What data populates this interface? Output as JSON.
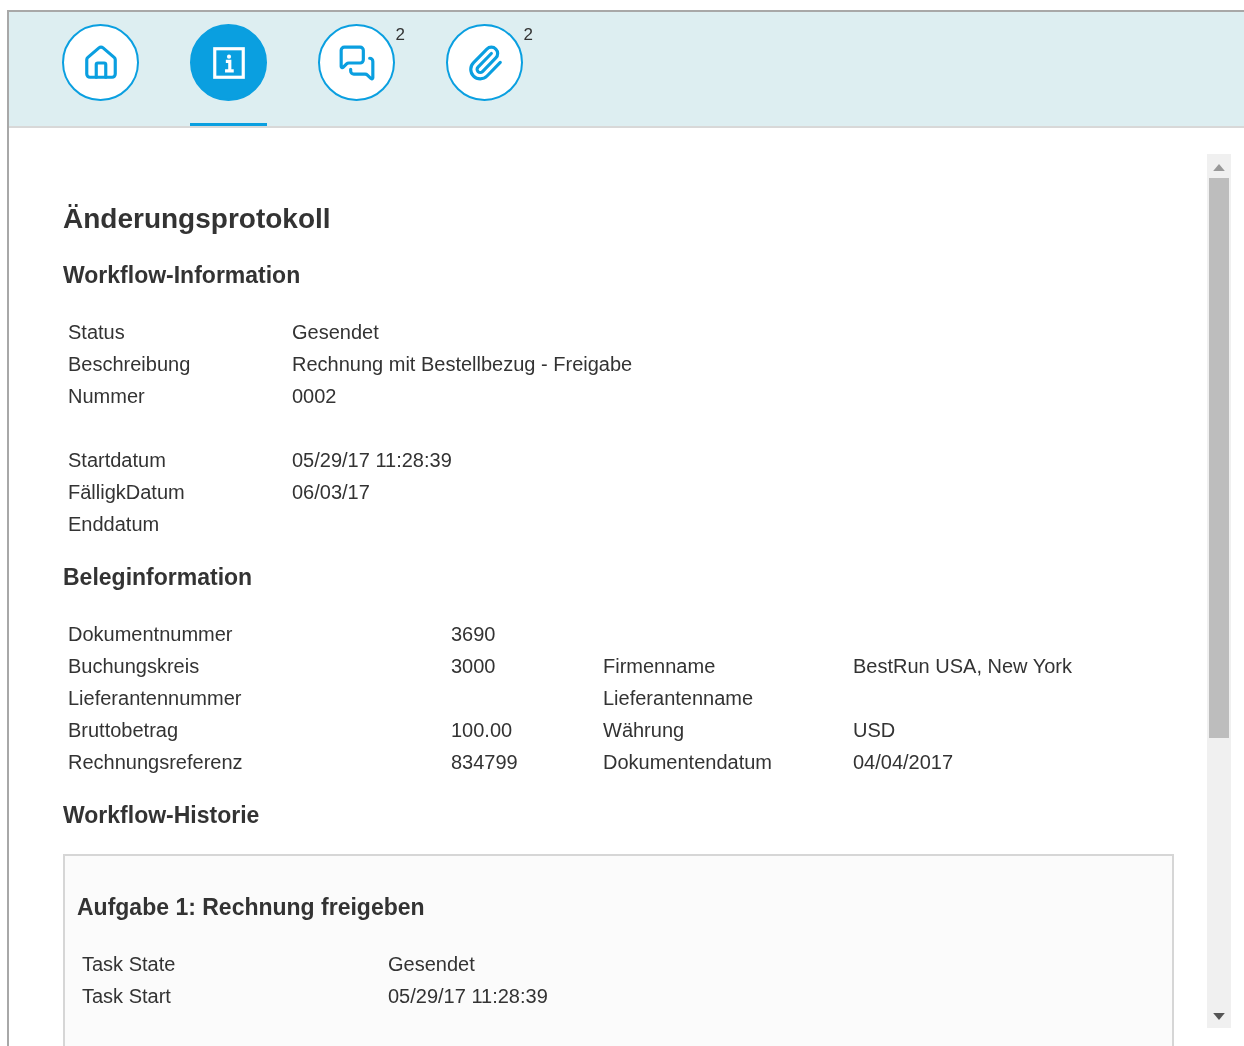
{
  "tabs": [
    {
      "kind": "home",
      "selected": false
    },
    {
      "kind": "info",
      "selected": true
    },
    {
      "kind": "comments",
      "selected": false,
      "count": "2"
    },
    {
      "kind": "attachments",
      "selected": false,
      "count": "2"
    }
  ],
  "title": "Änderungsprotokoll",
  "workflow_information": {
    "title": "Workflow-Information",
    "groups": [
      [
        {
          "label": "Status",
          "value": "Gesendet"
        },
        {
          "label": "Beschreibung",
          "value": "Rechnung mit Bestellbezug - Freigabe"
        },
        {
          "label": "Nummer",
          "value": "0002"
        }
      ],
      [
        {
          "label": "Startdatum",
          "value": "05/29/17 11:28:39"
        },
        {
          "label": "FälligkDatum",
          "value": "06/03/17"
        },
        {
          "label": "Enddatum"
        }
      ]
    ]
  },
  "document_information": {
    "title": "Beleginformation",
    "rows": [
      {
        "label": "Dokumentnummer",
        "value": "3690"
      },
      {
        "label": "Buchungskreis",
        "value": "3000",
        "label_2": "Firmenname",
        "value_2": "BestRun USA, New York"
      },
      {
        "label": "Lieferantennummer",
        "label_2": "Lieferantenname"
      },
      {
        "label": "Bruttobetrag",
        "value": "100.00",
        "label_2": "Währung",
        "value_2": "USD"
      },
      {
        "label": "Rechnungsreferenz",
        "value": "834799",
        "label_2": "Dokumentendatum",
        "value_2": "04/04/2017"
      }
    ]
  },
  "workflow_history": {
    "title": "Workflow-Historie",
    "tasks": [
      {
        "title": "Aufgabe 1: Rechnung freigeben",
        "rows": [
          {
            "label": "Task State",
            "value": "Gesendet"
          },
          {
            "label": "Task Start",
            "value": "05/29/17 11:28:39"
          }
        ]
      }
    ]
  }
}
